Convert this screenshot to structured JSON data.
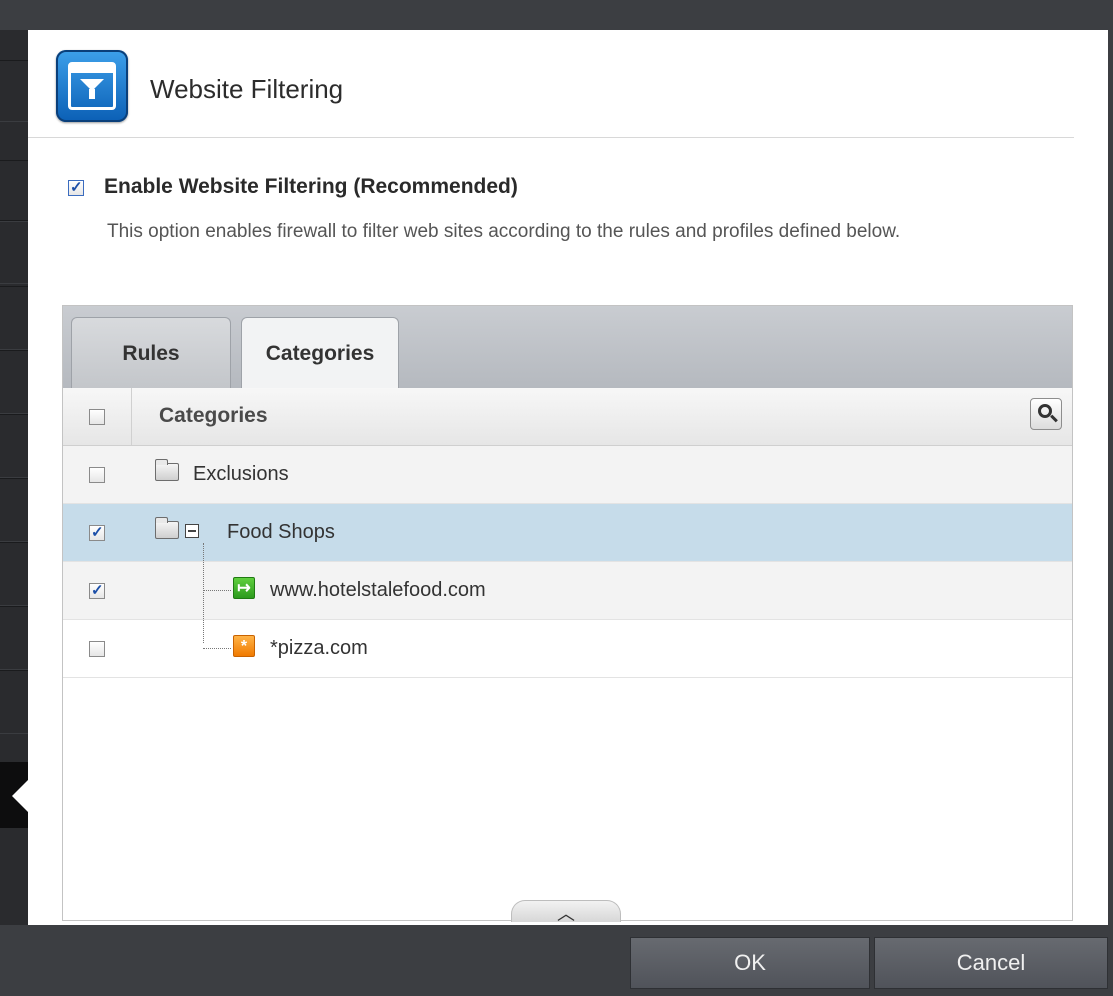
{
  "dialog": {
    "title": "Website Filtering",
    "enable_label": "Enable Website Filtering (Recommended)",
    "enable_checked": true,
    "description": "This option enables firewall to filter web sites according to the rules and profiles defined below."
  },
  "tabs": [
    {
      "label": "Rules",
      "active": false
    },
    {
      "label": "Categories",
      "active": true
    }
  ],
  "table": {
    "column_header": "Categories",
    "rows": [
      {
        "label": "Exclusions",
        "checked": false,
        "icon": "folder-icon"
      },
      {
        "label": "Food Shops",
        "checked": true,
        "icon": "folder-icon",
        "expanded": true,
        "selected": true
      },
      {
        "label": "www.hotelstalefood.com",
        "checked": true,
        "icon": "allow-site-icon"
      },
      {
        "label": "*pizza.com",
        "checked": false,
        "icon": "wildcard-site-icon"
      }
    ]
  },
  "footer": {
    "ok_label": "OK",
    "cancel_label": "Cancel"
  },
  "colors": {
    "selected_row": "#c6dcea",
    "footer_bg": "#3c3e42",
    "accent_blue": "#1c4fa8"
  }
}
